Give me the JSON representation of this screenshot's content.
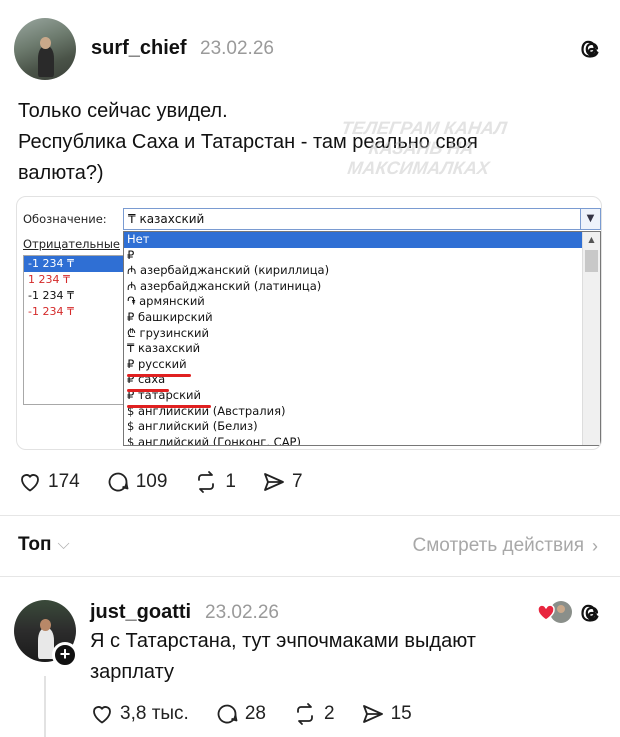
{
  "post": {
    "username": "surf_chief",
    "date": "23.02.26",
    "text_lines": [
      "Только сейчас увидел.",
      "Республика Саха и Татарстан - там реально своя",
      "валюта?)"
    ],
    "watermark": [
      "ТЕЛЕГРАМ КАНАЛ",
      "КАЗАНЬ НА МАКСИМАЛКАХ"
    ],
    "stats": {
      "likes": "174",
      "comments": "109",
      "reposts": "1",
      "shares": "7"
    }
  },
  "dialog": {
    "symbol_label": "Обозначение:",
    "symbol_value": "₸ казахский",
    "negative_label": "Отрицательные",
    "negative_items": [
      "-1 234 ₸",
      "1 234 ₸",
      "-1 234 ₸",
      "-1 234 ₸"
    ],
    "dropdown_items": [
      "Нет",
      "₽",
      "₼ азербайджанский (кириллица)",
      "₼ азербайджанский (латиница)",
      "֏ армянский",
      "₽ башкирский",
      "₾ грузинский",
      "₸ казахский",
      "₽ русский",
      "₽ саха",
      "₽ татарский",
      "$ английский (Австралия)",
      "$ английский (Белиз)",
      "$ английский (Гонконг, САР)"
    ],
    "underline_color": "#e02020"
  },
  "sort": {
    "label": "Топ",
    "view_activity": "Смотреть действия"
  },
  "reply": {
    "username": "just_goatti",
    "date": "23.02.26",
    "text_lines": [
      "Я с Татарстана, тут эчпочмаками выдают",
      "зарплату"
    ],
    "stats": {
      "likes": "3,8 тыс.",
      "comments": "28",
      "reposts": "2",
      "shares": "15"
    }
  }
}
